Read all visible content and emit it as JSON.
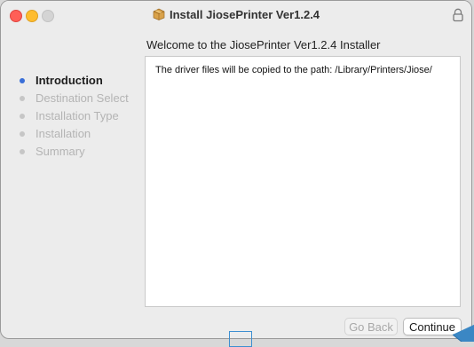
{
  "window": {
    "title": "Install JiosePrinter Ver1.2.4",
    "title_icon": "package-icon"
  },
  "heading": "Welcome to the JiosePrinter Ver1.2.4 Installer",
  "sidebar": {
    "steps": [
      {
        "label": "Introduction",
        "active": true
      },
      {
        "label": "Destination Select",
        "active": false
      },
      {
        "label": "Installation Type",
        "active": false
      },
      {
        "label": "Installation",
        "active": false
      },
      {
        "label": "Summary",
        "active": false
      }
    ]
  },
  "content": {
    "message": "The driver files will be copied to the path: /Library/Printers/Jiose/"
  },
  "buttons": {
    "go_back": "Go Back",
    "continue": "Continue"
  },
  "colors": {
    "active_dot": "#3a6fd8",
    "close": "#ff5f57",
    "minimize": "#febc2e"
  }
}
